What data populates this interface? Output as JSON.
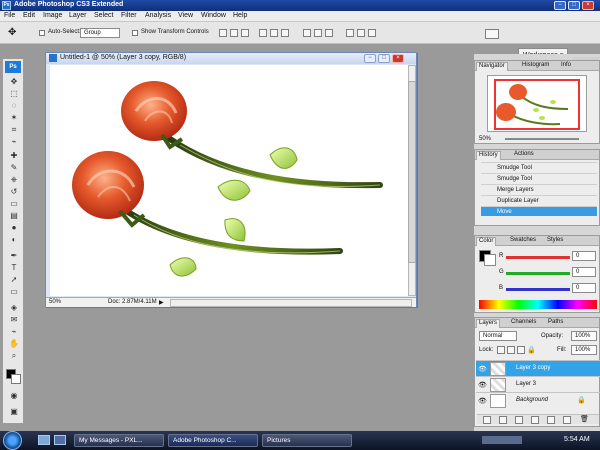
{
  "app": {
    "title": "Adobe Photoshop CS3 Extended"
  },
  "menu": [
    "File",
    "Edit",
    "Image",
    "Layer",
    "Select",
    "Filter",
    "Analysis",
    "View",
    "Window",
    "Help"
  ],
  "options": {
    "auto_select_label": "Auto-Select:",
    "auto_select_value": "Group",
    "show_transform_label": "Show Transform Controls",
    "workspace_label": "Workspace ▾"
  },
  "document": {
    "title": "Untitled-1 @ 50% (Layer 3 copy, RGB/8)",
    "zoom": "50%",
    "doc_size": "Doc: 2.87M/4.11M"
  },
  "navigator": {
    "tabs": [
      "Navigator",
      "Histogram",
      "Info"
    ],
    "zoom": "50%"
  },
  "history": {
    "tabs": [
      "History",
      "Actions"
    ],
    "items": [
      "Smudge Tool",
      "Smudge Tool",
      "Merge Layers",
      "Duplicate Layer",
      "Move"
    ]
  },
  "color": {
    "tabs": [
      "Color",
      "Swatches",
      "Styles"
    ],
    "channels": [
      {
        "name": "R",
        "value": "0"
      },
      {
        "name": "G",
        "value": "0"
      },
      {
        "name": "B",
        "value": "0"
      }
    ]
  },
  "layers": {
    "tabs": [
      "Layers",
      "Channels",
      "Paths"
    ],
    "blend_mode": "Normal",
    "opacity_label": "Opacity:",
    "opacity": "100%",
    "lock_label": "Lock:",
    "fill_label": "Fill:",
    "fill": "100%",
    "items": [
      "Layer 3 copy",
      "Layer 3",
      "Background"
    ]
  },
  "taskbar": {
    "items": [
      "My Messages - PXL...",
      "Adobe Photoshop C...",
      "Pictures"
    ],
    "time": "5:54 AM"
  },
  "colors": {
    "accent": "#3a9be5",
    "title_blue": "#1f4aa6"
  },
  "icons": [
    "photoshop-icon",
    "minimize-icon",
    "restore-icon",
    "close-icon",
    "move-tool-icon",
    "eye-icon",
    "lock-icon",
    "trash-icon"
  ]
}
